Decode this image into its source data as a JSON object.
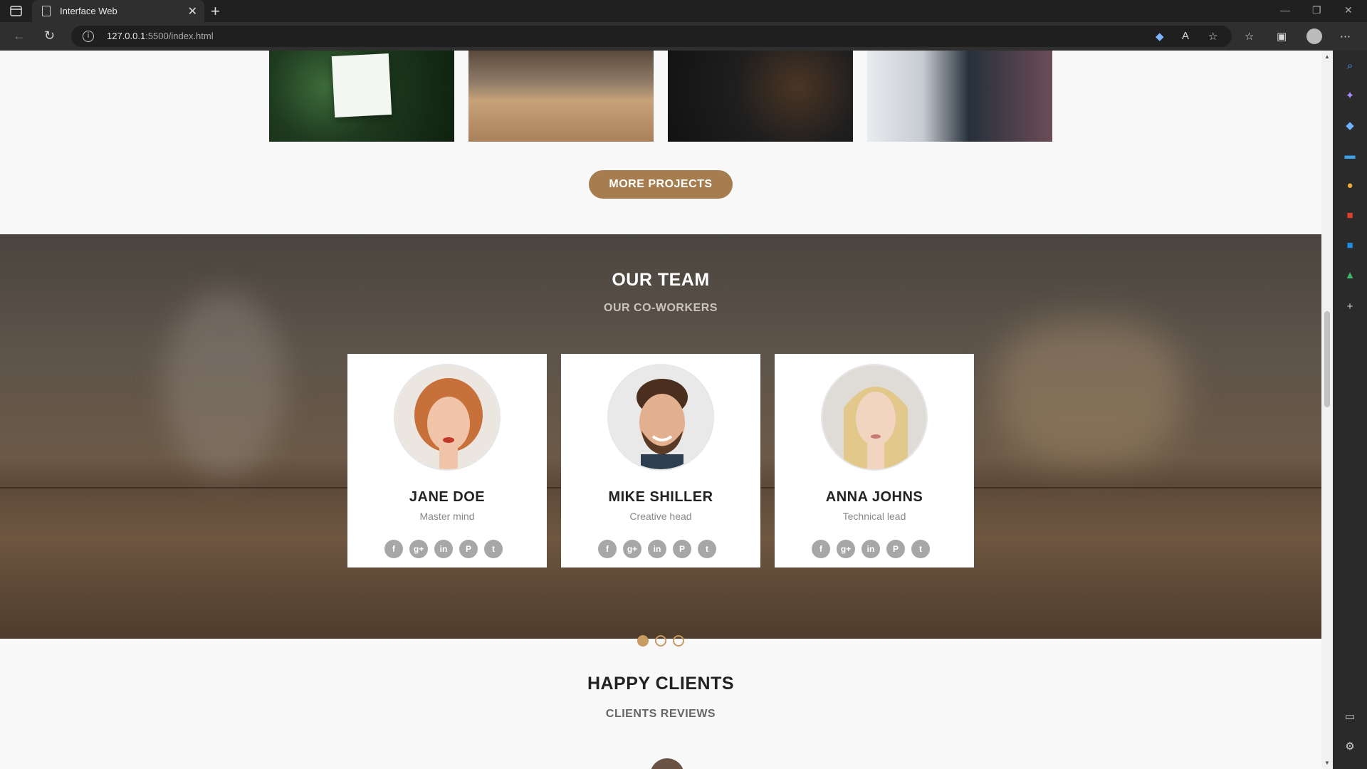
{
  "browser": {
    "tab_title": "Interface Web",
    "url_host": "127.0.0.1",
    "url_rest": ":5500/index.html",
    "new_tab_symbol": "+",
    "close_symbol": "✕"
  },
  "projects": {
    "more_button_label": "MORE PROJECTS"
  },
  "team": {
    "title": "OUR TEAM",
    "subtitle": "OUR CO-WORKERS",
    "members": [
      {
        "name": "JANE DOE",
        "role": "Master mind"
      },
      {
        "name": "MIKE SHILLER",
        "role": "Creative head"
      },
      {
        "name": "ANNA JOHNS",
        "role": "Technical lead"
      }
    ],
    "socials": [
      "facebook-icon",
      "google-plus-icon",
      "linkedin-icon",
      "pinterest-icon",
      "twitter-icon"
    ],
    "social_glyphs": [
      "f",
      "g+",
      "in",
      "P",
      "t"
    ],
    "carousel_active_index": 0,
    "carousel_count": 3
  },
  "clients": {
    "title": "HAPPY CLIENTS",
    "subtitle": "CLIENTS REVIEWS"
  },
  "colors": {
    "accent": "#a57d4e",
    "dot": "#c89b60",
    "browser_dark": "#202020"
  }
}
